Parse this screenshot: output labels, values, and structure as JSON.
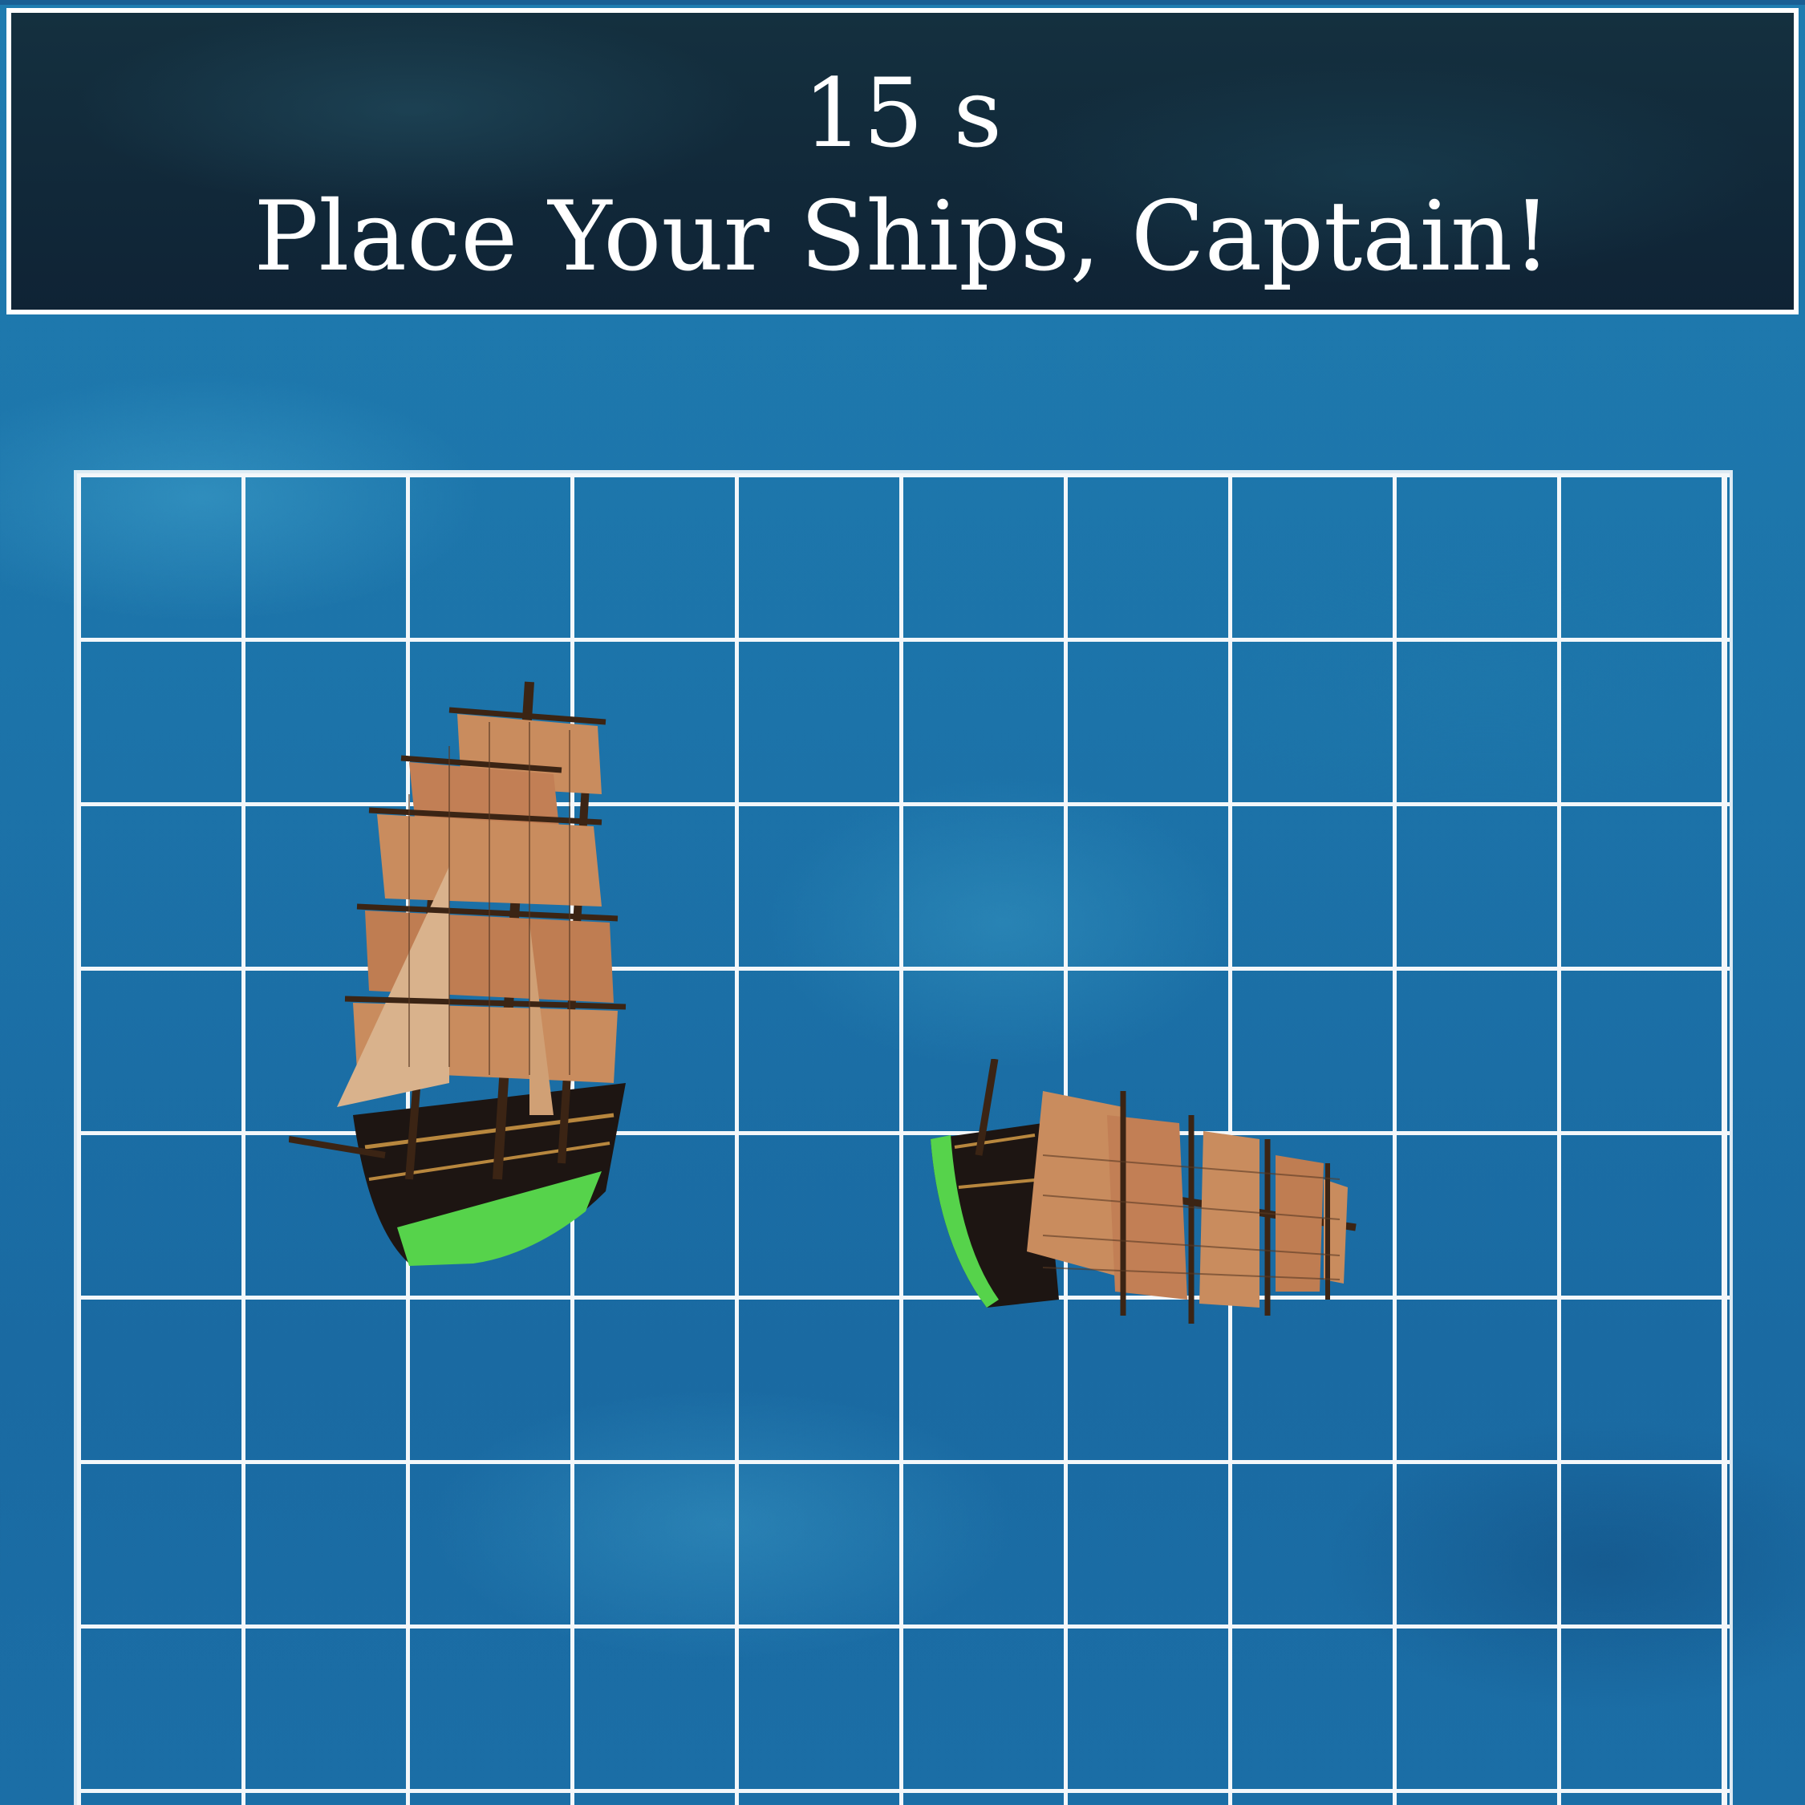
{
  "header": {
    "timer": "15 s",
    "title": "Place Your Ships, Captain!"
  },
  "board": {
    "rows": 10,
    "columns": 10,
    "line_color": "#f3f7fa",
    "water_color": "#1c73a9"
  },
  "ships": [
    {
      "name": "ship-1",
      "icon": "sailing-ship-icon",
      "orientation": "vertical"
    },
    {
      "name": "ship-2",
      "icon": "sailing-ship-icon",
      "orientation": "horizontal"
    }
  ],
  "colors": {
    "banner_bg": "#0f2335",
    "banner_text": "#ffffff",
    "sail": "#c98c5e",
    "hull": "#1d1512",
    "hull_stripe": "#56d34b"
  }
}
